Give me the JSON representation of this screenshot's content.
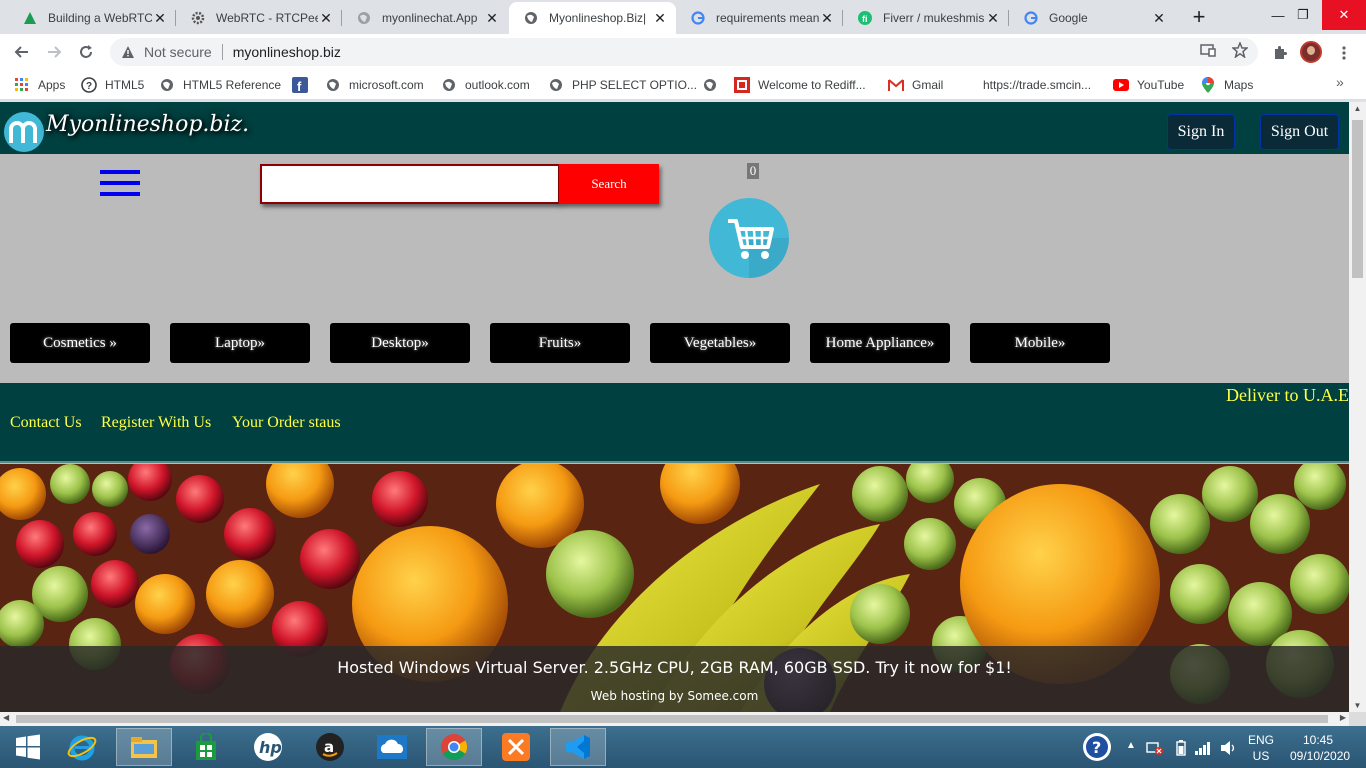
{
  "browser": {
    "tabs": [
      {
        "title": "Building a WebRTC",
        "icon": "green-triangle-icon"
      },
      {
        "title": "WebRTC - RTCPeer",
        "icon": "gear-icon"
      },
      {
        "title": "myonlinechat.App",
        "icon": "globe-icon"
      },
      {
        "title": "Myonlineshop.Biz|",
        "icon": "globe-icon",
        "active": true
      },
      {
        "title": "requirements mean",
        "icon": "google-icon"
      },
      {
        "title": "Fiverr / mukeshmis",
        "icon": "fiverr-icon"
      },
      {
        "title": "Google",
        "icon": "google-icon"
      }
    ],
    "tab_close_glyph": "✕",
    "new_tab_glyph": "+",
    "window_controls": {
      "minimize": "—",
      "restore": "❐",
      "close": "✕"
    },
    "address": {
      "security_label": "Not secure",
      "url": "myonlineshop.biz"
    },
    "bookmarks": [
      {
        "label": "Apps",
        "icon": "apps-grid-icon"
      },
      {
        "label": "HTML5",
        "icon": "help-circle-icon"
      },
      {
        "label": "HTML5 Reference",
        "icon": "globe-icon"
      },
      {
        "label": "",
        "icon": "facebook-icon"
      },
      {
        "label": "microsoft.com",
        "icon": "globe-icon"
      },
      {
        "label": "outlook.com",
        "icon": "globe-icon"
      },
      {
        "label": "PHP SELECT OPTIO...",
        "icon": "globe-icon"
      },
      {
        "label": "",
        "icon": "globe-icon"
      },
      {
        "label": "Welcome to Rediff...",
        "icon": "rediff-icon"
      },
      {
        "label": "Gmail",
        "icon": "gmail-icon"
      },
      {
        "label": "https://trade.smcin...",
        "icon": ""
      },
      {
        "label": "YouTube",
        "icon": "youtube-icon"
      },
      {
        "label": "Maps",
        "icon": "maps-pin-icon"
      }
    ],
    "bookmarks_more": "»"
  },
  "site": {
    "logo_text": "Myonlineshop.biz.",
    "sign_in": "Sign In",
    "sign_out": "Sign Out",
    "search_button": "Search",
    "search_value": "",
    "cart_count": "0",
    "categories": [
      "Cosmetics »",
      "Laptop»",
      "Desktop»",
      "Fruits»",
      "Vegetables»",
      "Home Appliance»",
      "Mobile»"
    ],
    "marquee": "Deliver to U.A.E",
    "footer_links": [
      "Contact Us",
      "Register With Us",
      "Your Order staus"
    ],
    "ad_main": "Hosted Windows Virtual Server. 2.5GHz CPU, 2GB RAM, 60GB SSD. Try it now for $1!",
    "ad_sub": "Web hosting by Somee.com",
    "colors": {
      "header": "#004040",
      "body": "#bbbbbb",
      "search": "#ff0000",
      "link": "#ffff44",
      "hamburger": "#0000ee",
      "cart": "#41b8d6"
    }
  },
  "taskbar": {
    "apps": [
      "start-icon",
      "internet-explorer-icon",
      "file-explorer-icon",
      "store-icon",
      "hp-icon",
      "amazon-icon",
      "onedrive-icon",
      "chrome-icon",
      "xampp-icon",
      "vscode-icon"
    ],
    "lang_top": "ENG",
    "lang_bottom": "US",
    "time": "10:45",
    "date": "09/10/2020"
  }
}
